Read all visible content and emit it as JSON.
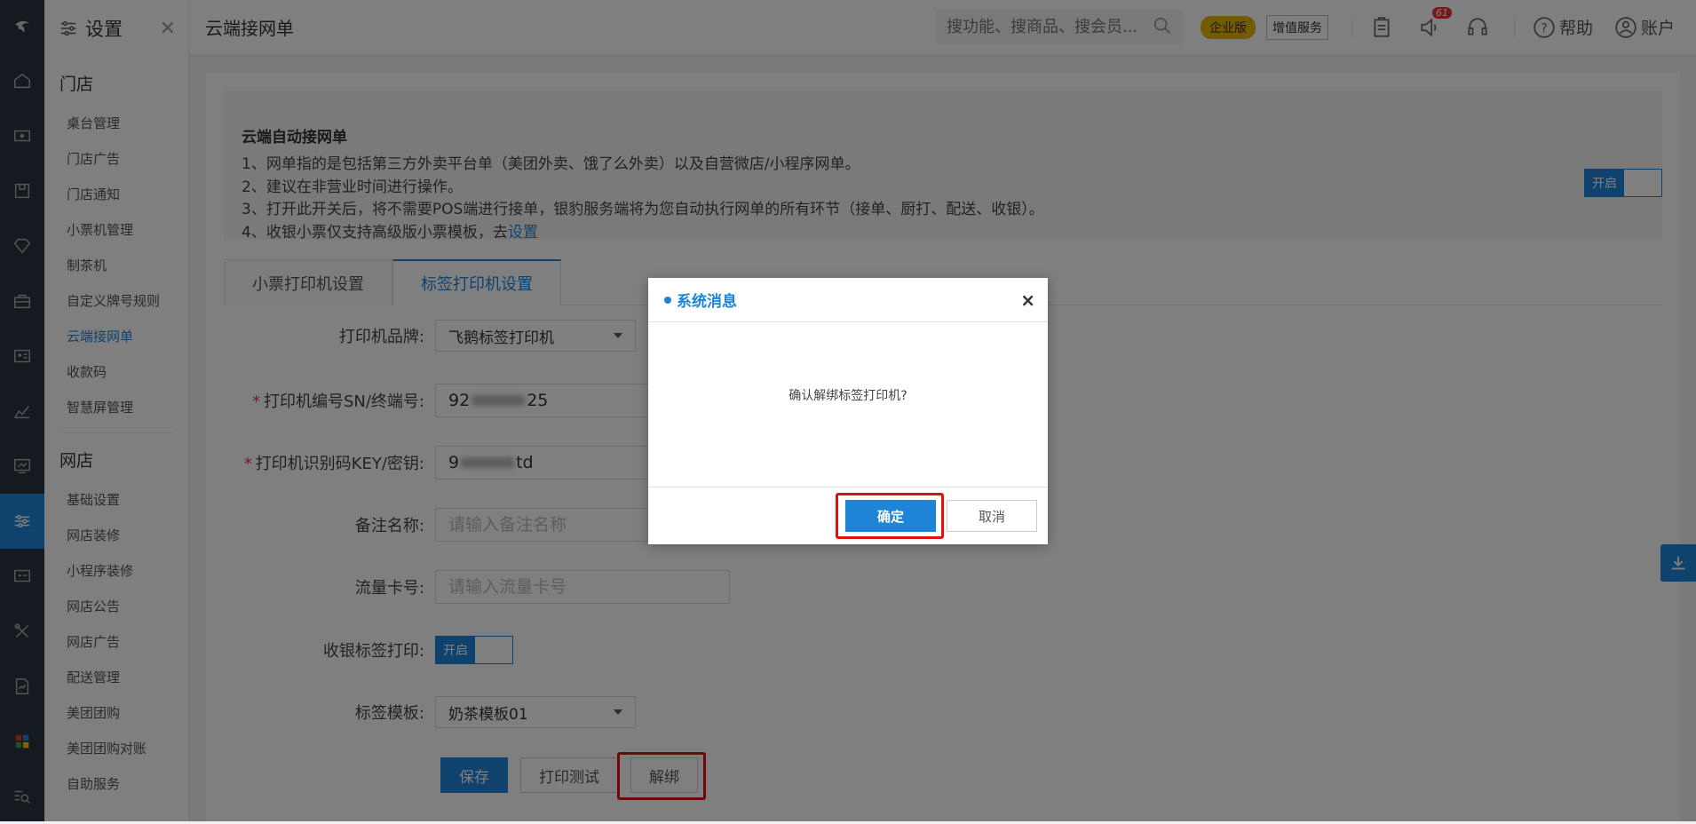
{
  "sidebar": {
    "title": "设置",
    "sections": [
      {
        "title": "门店",
        "items": [
          "桌台管理",
          "门店广告",
          "门店通知",
          "小票机管理",
          "制茶机",
          "自定义牌号规则",
          "云端接网单",
          "收款码",
          "智慧屏管理"
        ]
      },
      {
        "title": "网店",
        "items": [
          "基础设置",
          "网店装修",
          "小程序装修",
          "网店公告",
          "网店广告",
          "配送管理",
          "美团团购",
          "美团团购对账",
          "自助服务"
        ]
      }
    ],
    "active_item": "云端接网单"
  },
  "header": {
    "page_title": "云端接网单",
    "search_placeholder": "搜功能、搜商品、搜会员...",
    "edition_badge": "企业版",
    "vas_label": "增值服务",
    "notification_count": "61",
    "help_label": "帮助",
    "account_label": "账户"
  },
  "notice": {
    "title": "云端自动接网单",
    "line1": "1、网单指的是包括第三方外卖平台单（美团外卖、饿了么外卖）以及自营微店/小程序网单。",
    "line2": "2、建议在非营业时间进行操作。",
    "line3": "3、打开此开关后，将不需要POS端进行接单，银豹服务端将为您自动执行网单的所有环节（接单、厨打、配送、收银）。",
    "line4_prefix": "4、收银小票仅支持高级版小票模板，去",
    "line4_link": "设置",
    "toggle_label": "开启"
  },
  "tabs": [
    "小票打印机设置",
    "标签打印机设置"
  ],
  "form": {
    "brand_label": "打印机品牌:",
    "brand_value": "飞鹅标签打印机",
    "sn_label": "打印机编号SN/终端号:",
    "sn_prefix": "92",
    "sn_suffix": "25",
    "key_label": "打印机识别码KEY/密钥:",
    "key_prefix": "9",
    "key_suffix": "td",
    "note_label": "备注名称:",
    "note_placeholder": "请输入备注名称",
    "card_label": "流量卡号:",
    "card_placeholder": "请输入流量卡号",
    "label_print_label": "收银标签打印:",
    "label_print_toggle": "开启",
    "template_label": "标签模板:",
    "template_value": "奶茶模板01",
    "save_label": "保存",
    "test_label": "打印测试",
    "unbind_label": "解绑"
  },
  "modal": {
    "title": "系统消息",
    "message": "确认解绑标签打印机?",
    "ok_label": "确定",
    "cancel_label": "取消",
    "close_symbol": "×"
  },
  "colors": {
    "accent": "#1e84d8",
    "highlight": "#e01010",
    "rail": "#2a3240",
    "badge": "#e8b400"
  }
}
